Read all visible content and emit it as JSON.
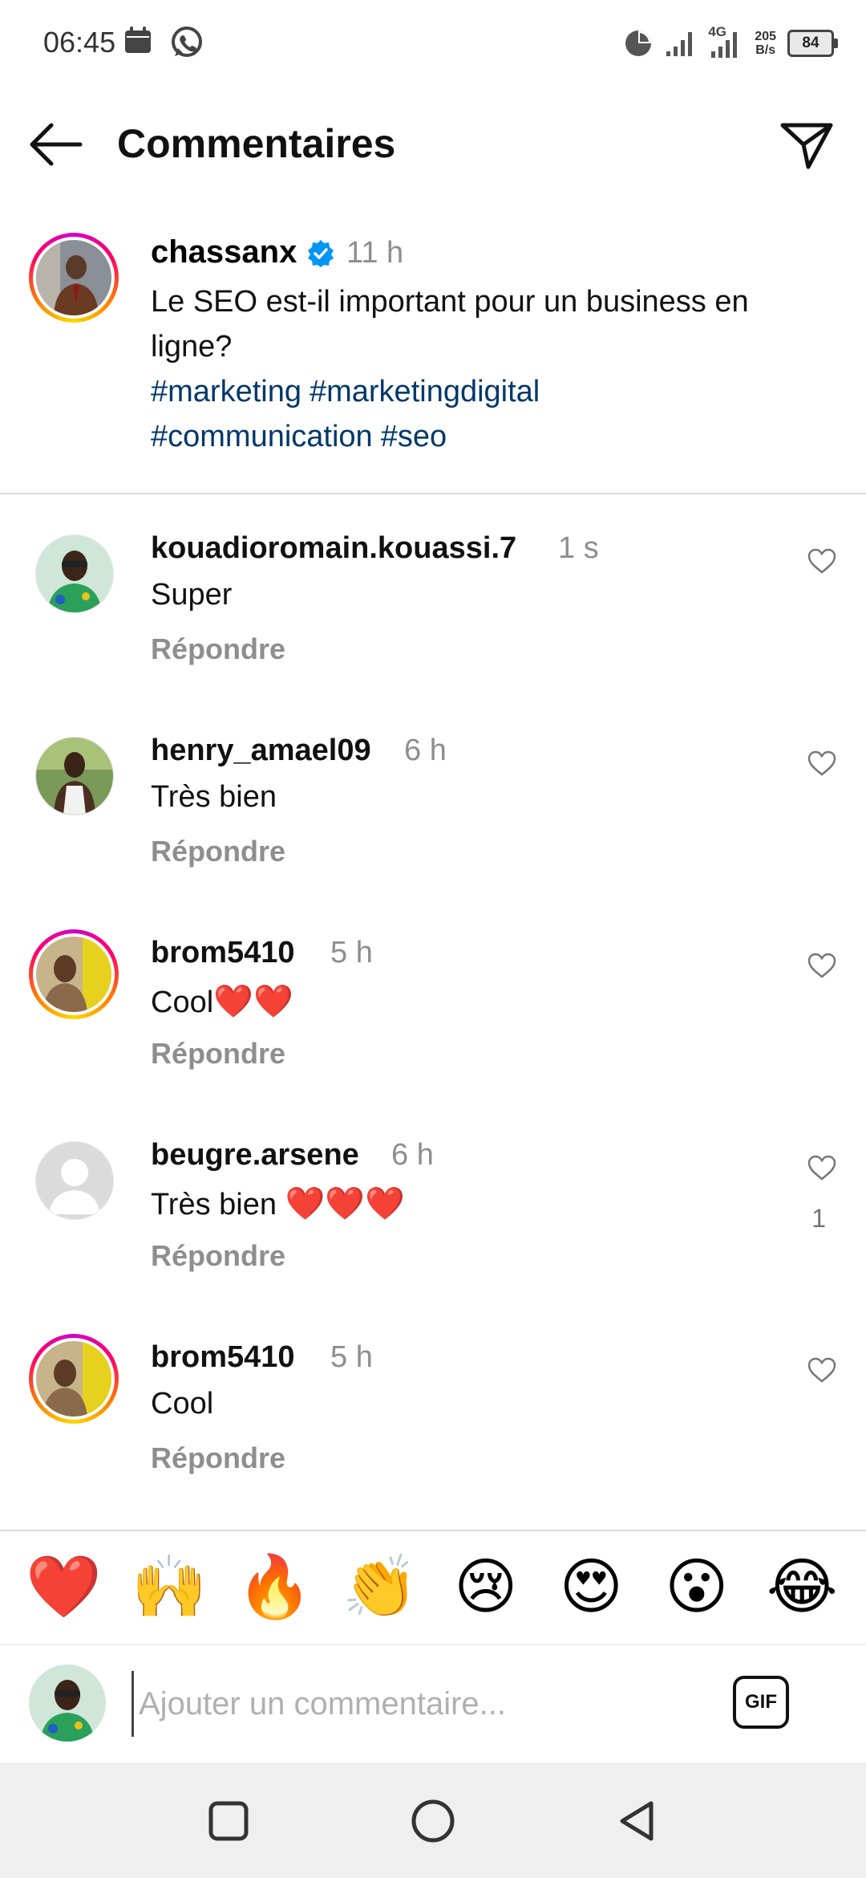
{
  "status_bar": {
    "time": "06:45",
    "network": "4G",
    "speed_value": "205",
    "speed_unit": "B/s",
    "battery": "84"
  },
  "header": {
    "title": "Commentaires"
  },
  "post": {
    "username": "chassanx",
    "verified": true,
    "time": "11 h",
    "text": "Le SEO est-il important pour un business en ligne?",
    "hashtags": [
      "#marketing",
      "#marketingdigital",
      "#communication",
      "#seo"
    ]
  },
  "comments": [
    {
      "username": "kouadioromain.kouassi.7",
      "time": "1 s",
      "text": "Super",
      "hearts": "",
      "reply": "Répondre",
      "likes": ""
    },
    {
      "username": "henry_amael09",
      "time": "6 h",
      "text": "Très bien",
      "hearts": "",
      "reply": "Répondre",
      "likes": ""
    },
    {
      "username": "brom5410",
      "time": "5 h",
      "text": "Cool",
      "hearts": "❤️❤️",
      "reply": "Répondre",
      "likes": ""
    },
    {
      "username": "beugre.arsene",
      "time": "6 h",
      "text": "Très bien",
      "hearts": "❤️❤️❤️",
      "reply": "Répondre",
      "likes": "1"
    },
    {
      "username": "brom5410",
      "time": "5 h",
      "text": "Cool",
      "hearts": "",
      "reply": "Répondre",
      "likes": ""
    }
  ],
  "emoji_bar": [
    "❤️",
    "🙌",
    "🔥",
    "👏",
    "😢",
    "😍",
    "😮",
    "😂"
  ],
  "comment_input": {
    "placeholder": "Ajouter un commentaire...",
    "gif_label": "GIF"
  },
  "colors": {
    "hashtag": "#00376b",
    "secondary_text": "#8e8e8e",
    "verified_badge": "#0095f6",
    "heart": "#e0102a"
  }
}
